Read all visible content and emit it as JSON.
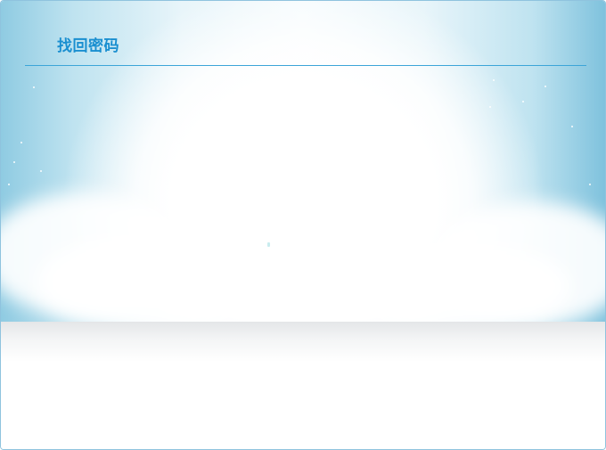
{
  "window": {
    "title": "找回密码"
  }
}
